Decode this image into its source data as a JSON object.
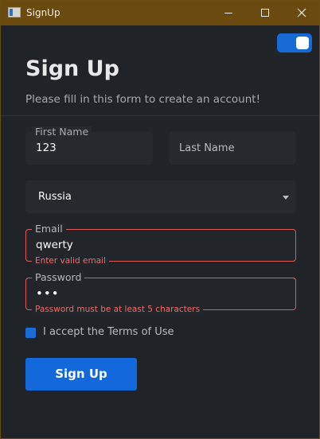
{
  "window": {
    "title": "SignUp",
    "controls": {
      "minimize": "minimize-icon",
      "maximize": "maximize-icon",
      "close": "close-icon"
    }
  },
  "theme_toggle": {
    "on": true,
    "icon": "toggle-switch-icon"
  },
  "header": {
    "title": "Sign Up",
    "subtitle": "Please fill in this form to create an account!"
  },
  "form": {
    "first_name": {
      "label": "First Name",
      "value": "123"
    },
    "last_name": {
      "placeholder": "Last Name",
      "value": ""
    },
    "country": {
      "selected": "Russia",
      "icon": "chevron-down-icon"
    },
    "email": {
      "label": "Email",
      "value": "qwerty",
      "error": "Enter valid email"
    },
    "password": {
      "label": "Password",
      "value": "•••",
      "error": "Password must be at least 5 characters"
    },
    "terms": {
      "label": "I accept the Terms of Use",
      "checked": true
    },
    "submit_label": "Sign Up"
  },
  "colors": {
    "accent": "#1369db",
    "error": "#e05a5a",
    "titlebar": "#6b4a10",
    "background": "#202327"
  }
}
